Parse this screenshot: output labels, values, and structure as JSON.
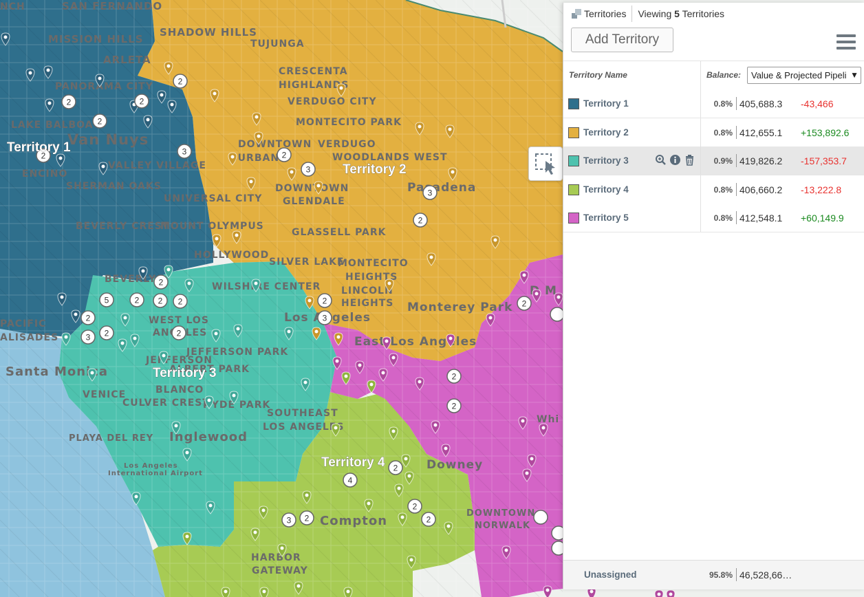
{
  "colors": {
    "territory1": "#2f6f8c",
    "territory2": "#e3b040",
    "territory3": "#4ec2ae",
    "territory4": "#a7cb54",
    "territory5": "#d464c6",
    "ocean": "#8fc3de",
    "land": "#eef1ee",
    "positive": "#1a8a1f",
    "negative": "#e8322f"
  },
  "panel": {
    "tab_label": "Territories",
    "viewing_prefix": "Viewing",
    "viewing_count": "5",
    "viewing_suffix": "Territories",
    "add_button": "Add Territory",
    "menu_icon": "hamburger-icon",
    "header": {
      "name": "Territory Name",
      "balance": "Balance:",
      "balance_select": "Value & Projected Pipeli"
    },
    "rows": [
      {
        "name": "Territory 1",
        "pct": "0.8%",
        "value": "405,688.3",
        "diff": "-43,466",
        "sign": "neg"
      },
      {
        "name": "Territory 2",
        "pct": "0.8%",
        "value": "412,655.1",
        "diff": "+153,892.6",
        "sign": "pos"
      },
      {
        "name": "Territory 3",
        "pct": "0.9%",
        "value": "419,826.2",
        "diff": "-157,353.7",
        "sign": "neg"
      },
      {
        "name": "Territory 4",
        "pct": "0.8%",
        "value": "406,660.2",
        "diff": "-13,222.8",
        "sign": "neg"
      },
      {
        "name": "Territory 5",
        "pct": "0.8%",
        "value": "412,548.1",
        "diff": "+60,149.9",
        "sign": "pos"
      }
    ],
    "row_icons": [
      "zoom-icon",
      "info-icon",
      "trash-icon"
    ],
    "unassigned": {
      "name": "Unassigned",
      "pct": "95.8%",
      "value": "46,528,66…"
    }
  },
  "map": {
    "territory_labels": [
      "Territory 1",
      "Territory 2",
      "Territory 3",
      "Territory 4",
      "Territory 5"
    ],
    "place_labels": [
      "NCH",
      "SAN FERNANDO",
      "MISSION HILLS",
      "ARLETA",
      "SHADOW HILLS",
      "TUJUNGA",
      "CRESCENTA",
      "HIGHLANDS",
      "VERDUGO CITY",
      "MONTECITO PARK",
      "DOWNTOWN",
      "BURBANK",
      "VERDUGO",
      "WOODLANDS WEST",
      "DOWNTOWN",
      "GLENDALE",
      "Pasadena",
      "PANORAMA CITY",
      "LAKE BALBOA",
      "Van Nuys",
      "VALLEY VILLAGE",
      "ENCINO",
      "SHERMAN OAKS",
      "UNIVERSAL CITY",
      "BEVERLY CREST",
      "MOUNT OLYMPUS",
      "HOLLYWOOD",
      "GLASSELL PARK",
      "SILVER LAKE",
      "MONTECITO",
      "HEIGHTS",
      "LINCOLN",
      "HEIGHTS",
      "Monterey Park",
      "BEVERLY",
      "WILSHIRE CENTER",
      "Los Angeles",
      "East Los Angeles",
      "WEST LOS",
      "ANGELES",
      "PACIFIC",
      "ALISADES",
      "Santa Monica",
      "JEFFERSON PARK",
      "JEFFERSON",
      "ALBERT PARK",
      "VENICE",
      "BLANCO",
      "CULVER CREST",
      "HYDE PARK",
      "SOUTHEAST",
      "LOS ANGELES",
      "PLAYA DEL REY",
      "Inglewood",
      "Los Angeles",
      "International Airport",
      "Downey",
      "DOWNTOWN",
      "NORWALK",
      "Compton",
      "HARBOR",
      "GATEWAY",
      "D M",
      "Whi"
    ],
    "cluster_counts": [
      "2",
      "2",
      "2",
      "2",
      "3",
      "2",
      "3",
      "3",
      "2",
      "2",
      "2",
      "5",
      "2",
      "2",
      "2",
      "3",
      "2",
      "2",
      "2",
      "2",
      "3",
      "2",
      "2",
      "2",
      "2",
      "4",
      "2",
      "2",
      "2",
      "3"
    ],
    "selection_tool_icon": "lasso-select-icon"
  }
}
